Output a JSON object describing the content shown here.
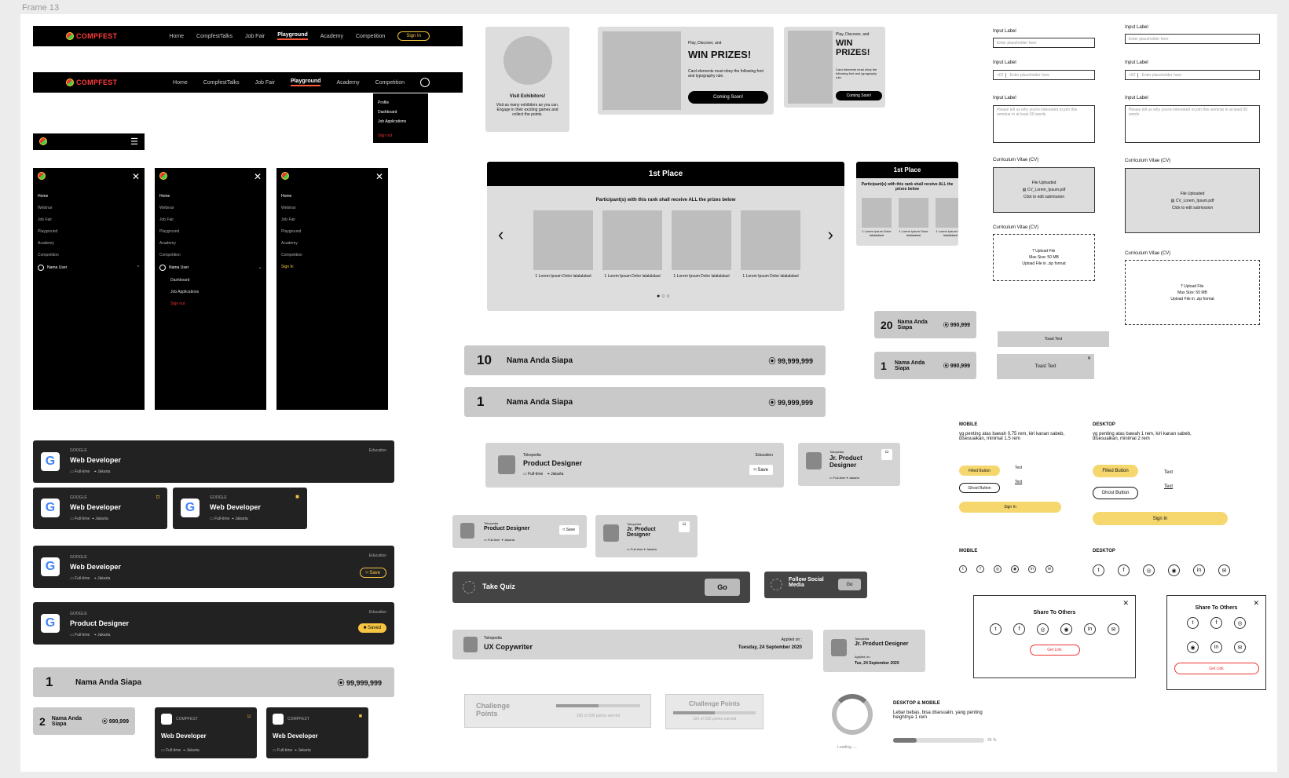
{
  "frame_title": "Frame 13",
  "brand": "COMPFEST",
  "navbar": {
    "links": [
      "Home",
      "CompfestTalks",
      "Job Fair",
      "Playground",
      "Academy",
      "Competition"
    ],
    "active": "Playground",
    "signin": "Sign In"
  },
  "dropdown": {
    "items": [
      "Profile",
      "Dashboard",
      "Job Applications"
    ],
    "signout": "Sign out"
  },
  "drawer": {
    "items": [
      "Home",
      "Webinar",
      "Job Fair",
      "Playground",
      "Academy",
      "Competition"
    ],
    "user": "Nama User",
    "sub_items": [
      "Dashboard",
      "Job Applications"
    ],
    "signout": "Sign out",
    "signin": "Sign In"
  },
  "exhibitor": {
    "title": "Visit Exhibitors!",
    "desc": "Visit as many exhibitors as you can. Engage in their exciting games and collect the points."
  },
  "prizes": {
    "kicker": "Play, Discover, and",
    "title": "WIN PRIZES!",
    "desc": "Card elements must obey the following font and typography rule.",
    "button": "Coming Soon!"
  },
  "first_place": {
    "title": "1st Place",
    "subtitle": "Participant(s) with this rank shall receive ALL the prizes below",
    "item": "1 Lorem Ipsum Dolor lalalalalasl"
  },
  "leaderboard": {
    "big": [
      {
        "rank": "10",
        "name": "Nama Anda Siapa",
        "points": "99,999,999"
      },
      {
        "rank": "1",
        "name": "Nama Anda Siapa",
        "points": "99,999,999"
      }
    ],
    "small": [
      {
        "rank": "20",
        "name": "Nama Anda Siapa",
        "points": "990,999"
      },
      {
        "rank": "1",
        "name": "Nama Anda Siapa",
        "points": "990,999"
      }
    ],
    "bottom_big": {
      "rank": "1",
      "name": "Nama Anda Siapa",
      "points": "99,999,999"
    },
    "bottom_small": {
      "rank": "2",
      "name": "Nama Anda Siapa",
      "points": "990,999"
    }
  },
  "toast": {
    "label1": "Toast Text",
    "label2": "Toast Text"
  },
  "jobs": {
    "company": "GOOGLE",
    "title": "Web Developer",
    "title2": "Product Designer",
    "type": "Full-time",
    "location": "Jakarta",
    "category": "Education",
    "save": "Save",
    "saved": "Saved",
    "compfest": "COMPFEST"
  },
  "toko": {
    "company": "Tokopedia",
    "pd": "Product Designer",
    "jpd": "Jr. Product Designer",
    "category": "Education",
    "save": "Save",
    "ux": "UX Copywriter",
    "applied_label": "Applied on :",
    "applied_date": "Tuesday, 24 September 2020",
    "applied_short": "Tue, 24 September 2020"
  },
  "quiz": {
    "label": "Take Quiz",
    "go": "Go"
  },
  "follow": {
    "label": "Follow Social Media",
    "go": "Go"
  },
  "challenge": {
    "label": "Challenge Points",
    "progress": "100 of 200 points earned",
    "fraction": 0.5
  },
  "forms": {
    "input_label": "Input Label",
    "placeholder": "Enter placeholder here",
    "prefix": "+62",
    "textarea": "Please tell us why you're interested to join this seminar in at least 50 words",
    "cv_label": "Curriculum Vitae (CV)",
    "file_uploaded": "File Uploaded",
    "file_name": "CV_Lorem_Ipsum.pdf",
    "file_name_small": "CV_Lorem_Ipsum.pdf",
    "edit": "Click to edit submission",
    "upload": "Upload File",
    "max": "Max Size: 50 MB",
    "format": "Upload File in .zip format"
  },
  "buttons": {
    "mobile_label": "MOBILE",
    "desktop_label": "DESKTOP",
    "mobile_note": "yg penting atas bawah 0.75 rem, kiri kanan sabeb, disesuaikan, minimal 1.5 rem",
    "desktop_note": "yg penting atas bawah 1 rem, kiri kanan sabeb, disesuaikan, minimal 2 rem",
    "filled": "Filled Button",
    "ghost": "Ghost Button",
    "text": "Text",
    "signin": "Sign In"
  },
  "social": {
    "mobile": "MOBILE",
    "desktop": "DESKTOP",
    "icons": [
      "twitter-icon",
      "facebook-icon",
      "instagram-icon",
      "line-icon",
      "linkedin-icon",
      "mail-icon"
    ]
  },
  "share": {
    "title": "Share To Others",
    "get_link": "Get Link"
  },
  "loading": {
    "label": "Loading ....",
    "title": "DESKTOP & MOBILE",
    "desc": "Lebar bebas, bisa disesuaiin, yang penting heightnya 1 rem",
    "percent": "26 %",
    "fraction": 0.26
  }
}
